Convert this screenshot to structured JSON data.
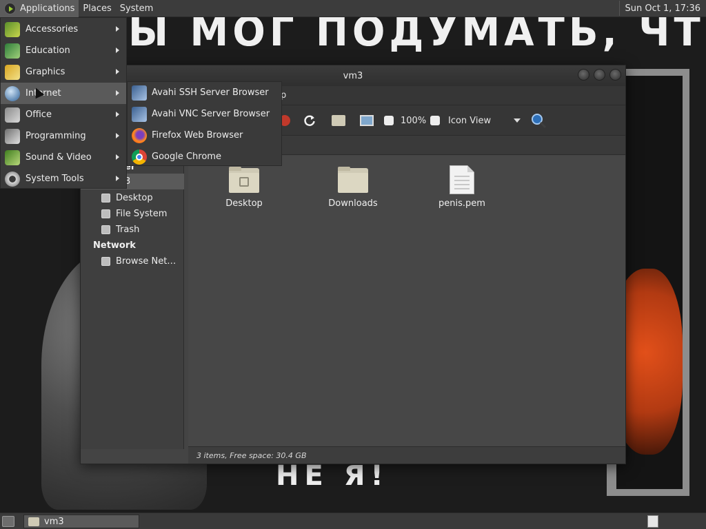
{
  "wallpaper": {
    "text_top": "Ы МОГ ПОДУМАТЬ, ЧТО Я –",
    "text_bottom": "НЕ Я!"
  },
  "top_panel": {
    "applications": "Applications",
    "places": "Places",
    "system": "System",
    "clock": "Sun Oct 1, 17:36"
  },
  "apps_menu": {
    "items": [
      {
        "label": "Accessories",
        "icon": "accessories-icon"
      },
      {
        "label": "Education",
        "icon": "education-icon"
      },
      {
        "label": "Graphics",
        "icon": "graphics-icon"
      },
      {
        "label": "Internet",
        "icon": "internet-icon"
      },
      {
        "label": "Office",
        "icon": "office-icon"
      },
      {
        "label": "Programming",
        "icon": "programming-icon"
      },
      {
        "label": "Sound & Video",
        "icon": "sound-video-icon"
      },
      {
        "label": "System Tools",
        "icon": "system-tools-icon"
      }
    ],
    "highlighted": "Internet"
  },
  "internet_submenu": {
    "items": [
      {
        "label": "Avahi SSH Server Browser",
        "icon": "avahi-ssh-icon"
      },
      {
        "label": "Avahi VNC Server Browser",
        "icon": "avahi-vnc-icon"
      },
      {
        "label": "Firefox Web Browser",
        "icon": "firefox-icon"
      },
      {
        "label": "Google Chrome",
        "icon": "chrome-icon"
      }
    ]
  },
  "window": {
    "title": "vm3",
    "menubar_visible_fragment": "p",
    "toolbar": {
      "zoom": "100%",
      "view_mode": "Icon View"
    },
    "sidebar": {
      "places_heading_fragment": "er",
      "selected_fragment": "3",
      "items": [
        "Desktop",
        "File System",
        "Trash"
      ],
      "network_heading": "Network",
      "network_items": [
        "Browse Net…"
      ]
    },
    "files": [
      {
        "name": "Desktop",
        "type": "folder"
      },
      {
        "name": "Downloads",
        "type": "folder"
      },
      {
        "name": "penis.pem",
        "type": "file"
      }
    ],
    "status": "3 items, Free space: 30.4 GB"
  },
  "bottom_panel": {
    "task_label": "vm3"
  }
}
